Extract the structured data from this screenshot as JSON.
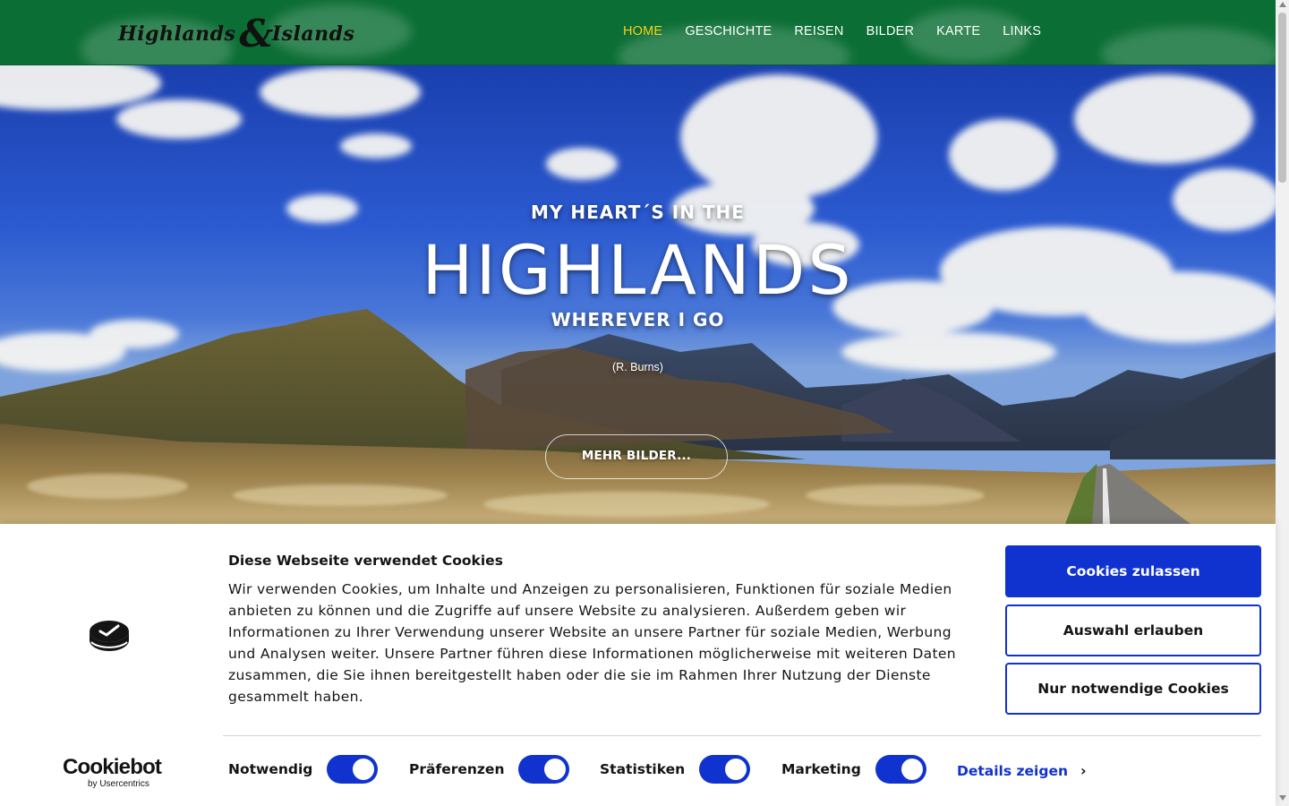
{
  "header": {
    "logo": {
      "word1": "Highlands",
      "amp": "&",
      "word2": "Islands"
    },
    "nav": [
      {
        "label": "HOME",
        "active": true
      },
      {
        "label": "GESCHICHTE",
        "active": false
      },
      {
        "label": "REISEN",
        "active": false
      },
      {
        "label": "BILDER",
        "active": false
      },
      {
        "label": "KARTE",
        "active": false
      },
      {
        "label": "LINKS",
        "active": false
      }
    ]
  },
  "hero": {
    "line1": "MY HEART´S IN THE",
    "title": "HIGHLANDS",
    "line2": "WHEREVER I GO",
    "credit": "(R. Burns)",
    "button": "MEHR BILDER..."
  },
  "cookie": {
    "title": "Diese Webseite verwendet Cookies",
    "body": "Wir verwenden Cookies, um Inhalte und Anzeigen zu personalisieren, Funktionen für soziale Medien anbieten zu können und die Zugriffe auf unsere Website zu analysieren. Außerdem geben wir Informationen zu Ihrer Verwendung unserer Website an unsere Partner für soziale Medien, Werbung und Analysen weiter. Unsere Partner führen diese Informationen möglicherweise mit weiteren Daten zusammen, die Sie ihnen bereitgestellt haben oder die sie im Rahmen Ihrer Nutzung der Dienste gesammelt haben.",
    "buttons": {
      "allow_all": "Cookies zulassen",
      "allow_selection": "Auswahl erlauben",
      "necessary_only": "Nur notwendige Cookies"
    },
    "toggles": [
      {
        "label": "Notwendig",
        "on": true
      },
      {
        "label": "Präferenzen",
        "on": true
      },
      {
        "label": "Statistiken",
        "on": true
      },
      {
        "label": "Marketing",
        "on": true
      }
    ],
    "details_link": "Details zeigen",
    "brand": {
      "name": "Cookiebot",
      "by": "by Usercentrics"
    },
    "accent_color": "#1032cf"
  }
}
